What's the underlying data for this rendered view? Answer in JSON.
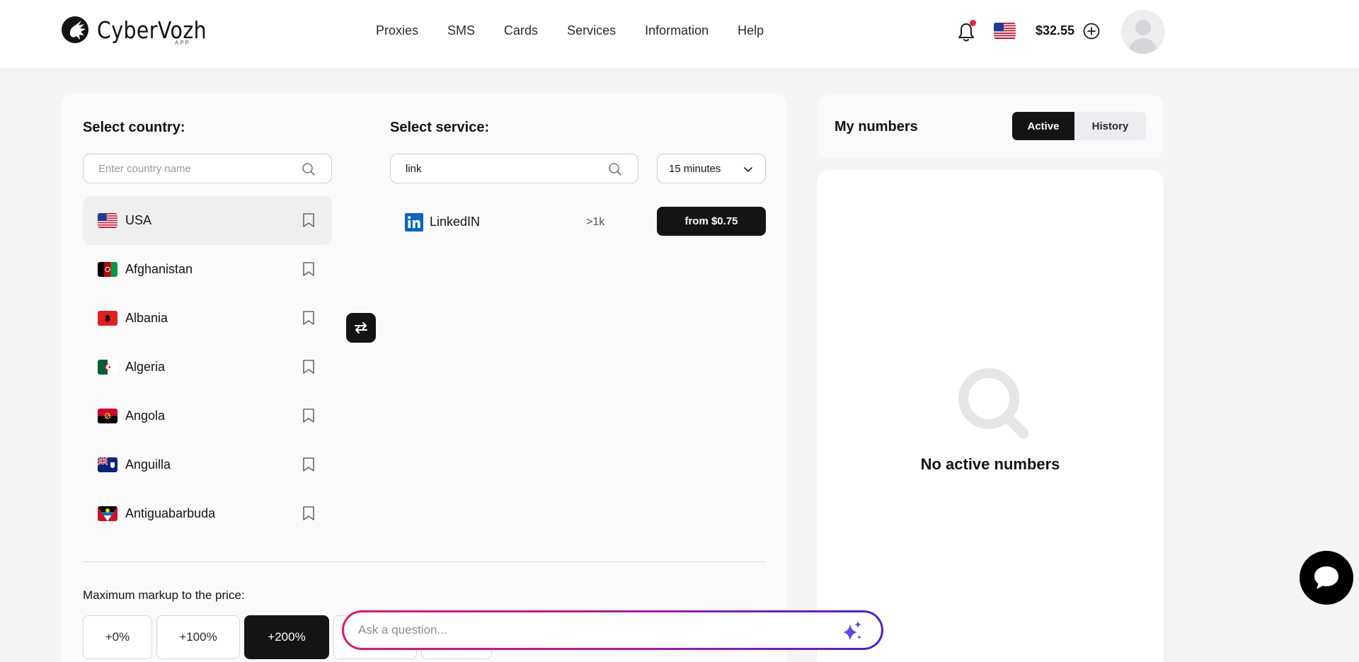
{
  "header": {
    "logo_text": "CyberVozh",
    "logo_sub": "APP",
    "nav": [
      "Proxies",
      "SMS",
      "Cards",
      "Services",
      "Information",
      "Help"
    ],
    "balance": "$32.55",
    "icons": {
      "notifications": "bell-icon",
      "add_balance": "plus-circle-icon",
      "avatar": "user-avatar-icon"
    }
  },
  "country_section": {
    "title": "Select country:",
    "search_placeholder": "Enter country name",
    "countries": [
      {
        "name": "USA",
        "selected": true
      },
      {
        "name": "Afghanistan"
      },
      {
        "name": "Albania"
      },
      {
        "name": "Algeria"
      },
      {
        "name": "Angola"
      },
      {
        "name": "Anguilla"
      },
      {
        "name": "Antiguabarbuda"
      }
    ]
  },
  "service_section": {
    "title": "Select service:",
    "search_value": "link",
    "duration": "15 minutes",
    "services": [
      {
        "name": "LinkedIN",
        "count": ">1k",
        "price_label": "from $0.75"
      }
    ]
  },
  "markup": {
    "label": "Maximum markup to the price:",
    "options": [
      "+0%",
      "+100%",
      "+200%"
    ],
    "active": "+200%"
  },
  "numbers": {
    "title": "My numbers",
    "tabs": [
      "Active",
      "History"
    ],
    "active_tab": "Active",
    "empty_text": "No active numbers"
  },
  "assistant": {
    "placeholder": "Ask a question..."
  },
  "colors": {
    "primary": "#141414",
    "background": "#f4f4f5",
    "card": "#fafafa",
    "notification_dot": "#e5283b",
    "linkedin": "#0a66c2",
    "gradient_start": "#e9136a",
    "gradient_end": "#4b1fd6"
  }
}
